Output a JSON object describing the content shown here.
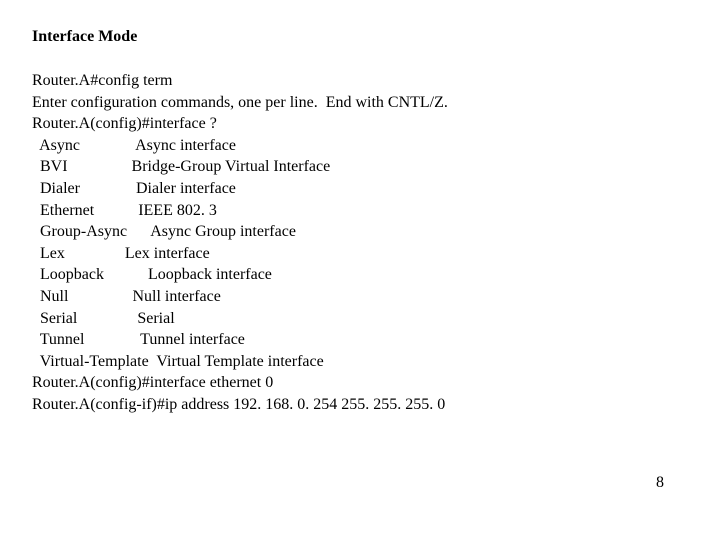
{
  "title": "Interface Mode",
  "lines": [
    "Router.A#config term",
    "Enter configuration commands, one per line.  End with CNTL/Z.",
    "Router.A(config)#interface ?",
    "  Async              Async interface",
    "  BVI                Bridge-Group Virtual Interface",
    "  Dialer              Dialer interface",
    "  Ethernet           IEEE 802. 3",
    "  Group-Async      Async Group interface",
    "  Lex               Lex interface",
    "  Loopback           Loopback interface",
    "  Null                Null interface",
    "  Serial               Serial",
    "  Tunnel              Tunnel interface",
    "  Virtual-Template  Virtual Template interface",
    "Router.A(config)#interface ethernet 0",
    "Router.A(config-if)#ip address 192. 168. 0. 254 255. 255. 255. 0"
  ],
  "page_number": "8"
}
